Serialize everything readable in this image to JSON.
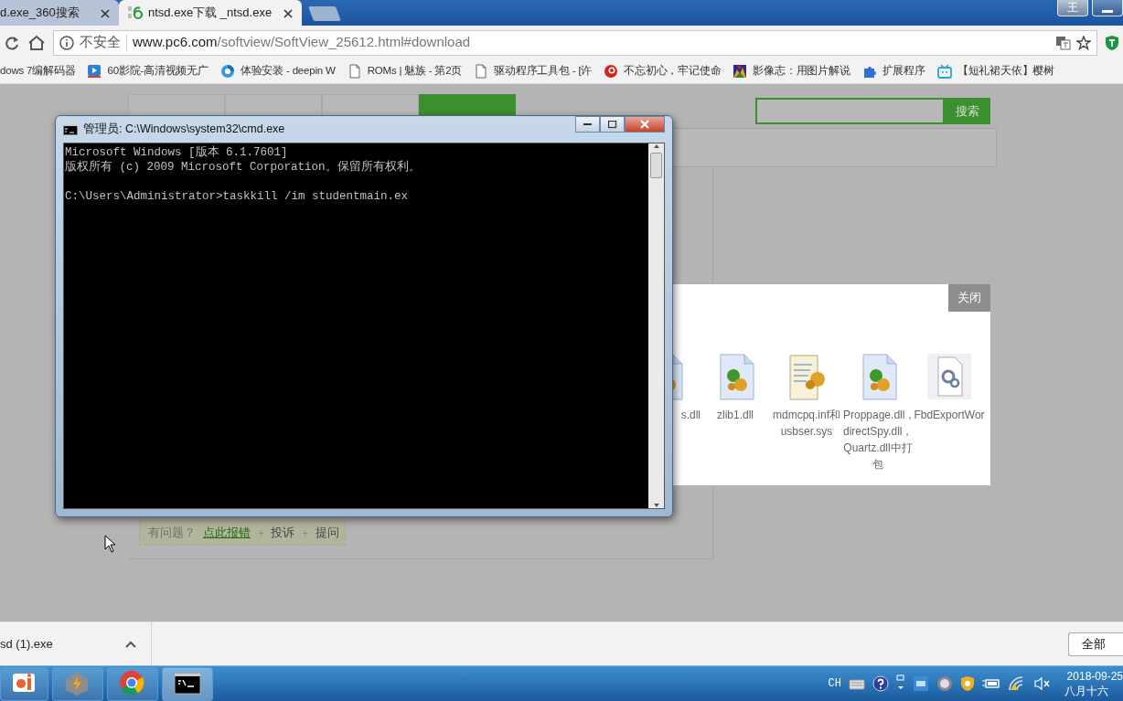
{
  "browser": {
    "tabs": [
      {
        "title": "d.exe_360搜索",
        "selected": false
      },
      {
        "title": "ntsd.exe下载 _ntsd.exe",
        "selected": true
      }
    ],
    "profile": "王",
    "security": "不安全",
    "url_domain": "www.pc6.com",
    "url_path": "/softview/SoftView_25612.html#download",
    "bookmarks": [
      {
        "title": "dows 7编解码器",
        "kind": "none"
      },
      {
        "title": "60影院-高清视频无广",
        "kind": "video"
      },
      {
        "title": "体验安装 - deepin W",
        "kind": "swirl"
      },
      {
        "title": "ROMs | 魅族 - 第2页",
        "kind": "page"
      },
      {
        "title": "驱动程序工具包 - [许",
        "kind": "page"
      },
      {
        "title": "不忘初心，牢记使命",
        "kind": "target"
      },
      {
        "title": "影像志：用图片解说",
        "kind": "mosaic"
      },
      {
        "title": "扩展程序",
        "kind": "puzzle"
      },
      {
        "title": "【短礼裙天依】樱树",
        "kind": "tv"
      }
    ]
  },
  "page": {
    "nav_tabs": [
      {
        "selected": false
      },
      {
        "selected": false
      },
      {
        "selected": false
      },
      {
        "selected": true
      }
    ],
    "search_button": "搜索",
    "help": [
      {
        "text": "有问题？",
        "kind": "text"
      },
      {
        "text": "点此报错",
        "kind": "link"
      },
      {
        "text": "+",
        "kind": "sep"
      },
      {
        "text": "投诉",
        "kind": "action"
      },
      {
        "text": "+",
        "kind": "sep"
      },
      {
        "text": "提问",
        "kind": "action"
      }
    ],
    "dialog": {
      "close": "关闭",
      "files": [
        {
          "name": "s.dll",
          "kind": "dll"
        },
        {
          "name": "zlib1.dll",
          "kind": "dll"
        },
        {
          "name": "mdmcpq.inf和usbser.sys",
          "kind": "inf"
        },
        {
          "name": "Proppage.dll，directSpy.dll，Quartz.dll中打包",
          "kind": "dll"
        },
        {
          "name": "FbdExportWor",
          "kind": "config"
        }
      ]
    }
  },
  "cmd_window": {
    "title": "管理员: C:\\Windows\\system32\\cmd.exe",
    "banner": [
      "Microsoft Windows [版本 6.1.7601]",
      "版权所有 (c) 2009 Microsoft Corporation。保留所有权利。"
    ],
    "prompt": "C:\\Users\\Administrator>taskkill /im studentmain.ex"
  },
  "downloads": {
    "file": "sd (1).exe",
    "show_all": "全部"
  },
  "taskbar": {
    "apps": [
      {
        "kind": "photos",
        "selected": false
      },
      {
        "kind": "bolt",
        "selected": false
      },
      {
        "kind": "chrome",
        "selected": false
      },
      {
        "kind": "console",
        "selected": true
      }
    ],
    "language": "CH",
    "date": "2018-09-25",
    "lunar": "八月十六"
  }
}
